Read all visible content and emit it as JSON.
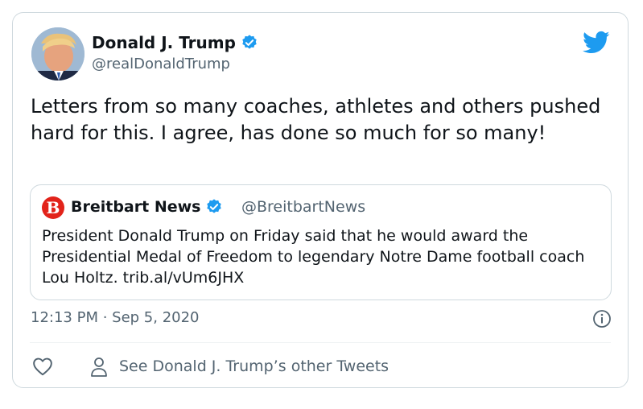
{
  "tweet": {
    "author_name": "Donald J. Trump",
    "author_handle": "@realDonaldTrump",
    "text": "Letters from so many coaches, athletes and others pushed hard for this. I agree, has done so much for so many!",
    "timestamp": "12:13 PM · Sep 5, 2020",
    "other_tweets_label": "See Donald J. Trump’s other Tweets"
  },
  "quoted": {
    "logo_letter": "B",
    "author_name": "Breitbart News",
    "author_handle": "@BreitbartNews",
    "text": "President Donald Trump on Friday said that he would award the Presidential Medal of Freedom to legendary Notre Dame football coach Lou Holtz. trib.al/vUm6JHX"
  },
  "icons": {
    "verified": "verified-badge-icon",
    "bird": "twitter-bird-icon",
    "info": "info-icon",
    "like": "heart-icon",
    "profile": "person-icon"
  },
  "colors": {
    "verified_blue": "#1d9bf0",
    "breitbart_red": "#e2231a",
    "secondary_text": "#536471",
    "border": "#cfd9de"
  }
}
